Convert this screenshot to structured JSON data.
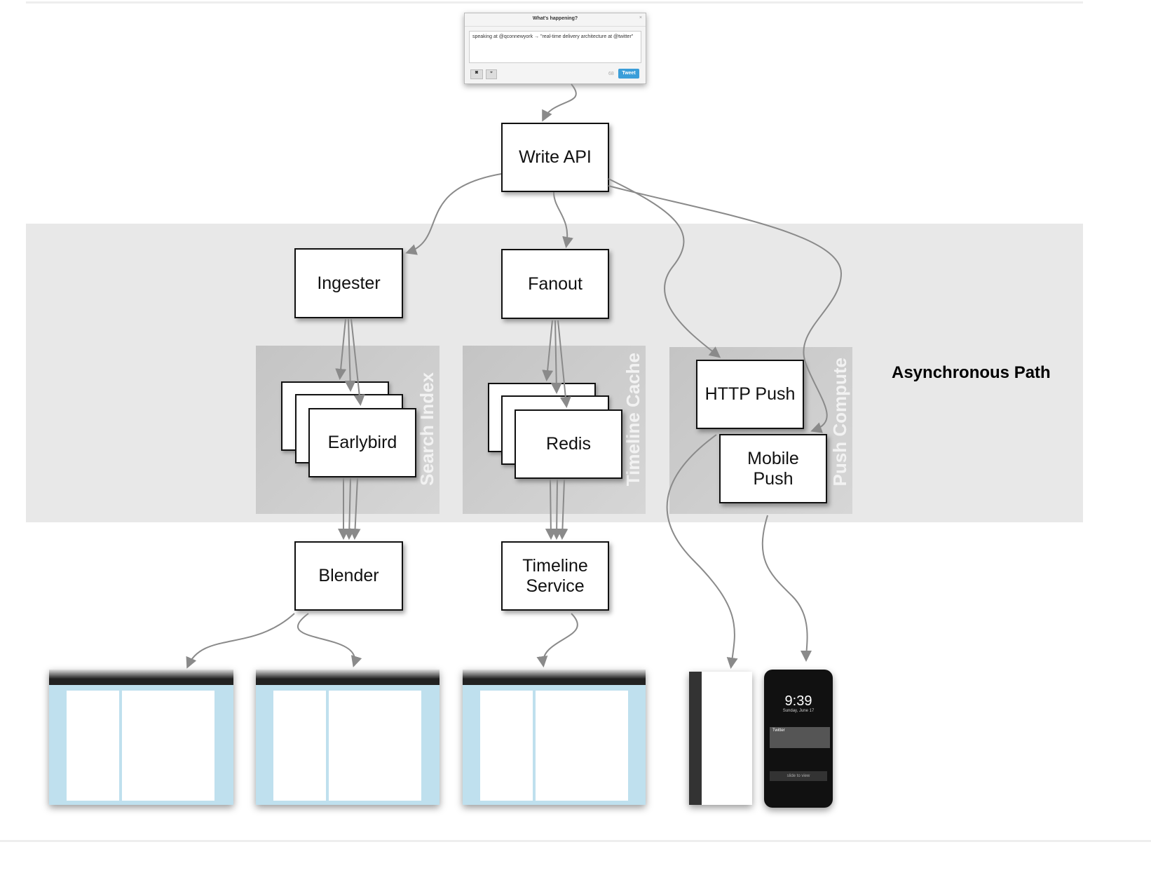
{
  "tweet_box": {
    "title": "What's happening?",
    "text": "speaking at @qconnewyork → \"real-time delivery architecture at @twitter\"",
    "button": "Tweet",
    "count": "68"
  },
  "nodes": {
    "write_api": "Write API",
    "ingester": "Ingester",
    "fanout": "Fanout",
    "earlybird": "Earlybird",
    "redis": "Redis",
    "http_push": "HTTP Push",
    "mobile_push": "Mobile Push",
    "blender": "Blender",
    "timeline_service": "Timeline Service"
  },
  "groups": {
    "search_index": "Search Index",
    "timeline_cache": "Timeline Cache",
    "push_compute": "Push Compute"
  },
  "region_label": "Asynchronous Path",
  "phone": {
    "time": "9:39",
    "date": "Sunday, June 17",
    "notification": "Twitter",
    "slider": "slide to view"
  },
  "colors": {
    "arrow": "#8a8a8a",
    "band": "#e8e8e8",
    "panel": "#c8c8c8",
    "tweet_button": "#3b9ed9"
  }
}
